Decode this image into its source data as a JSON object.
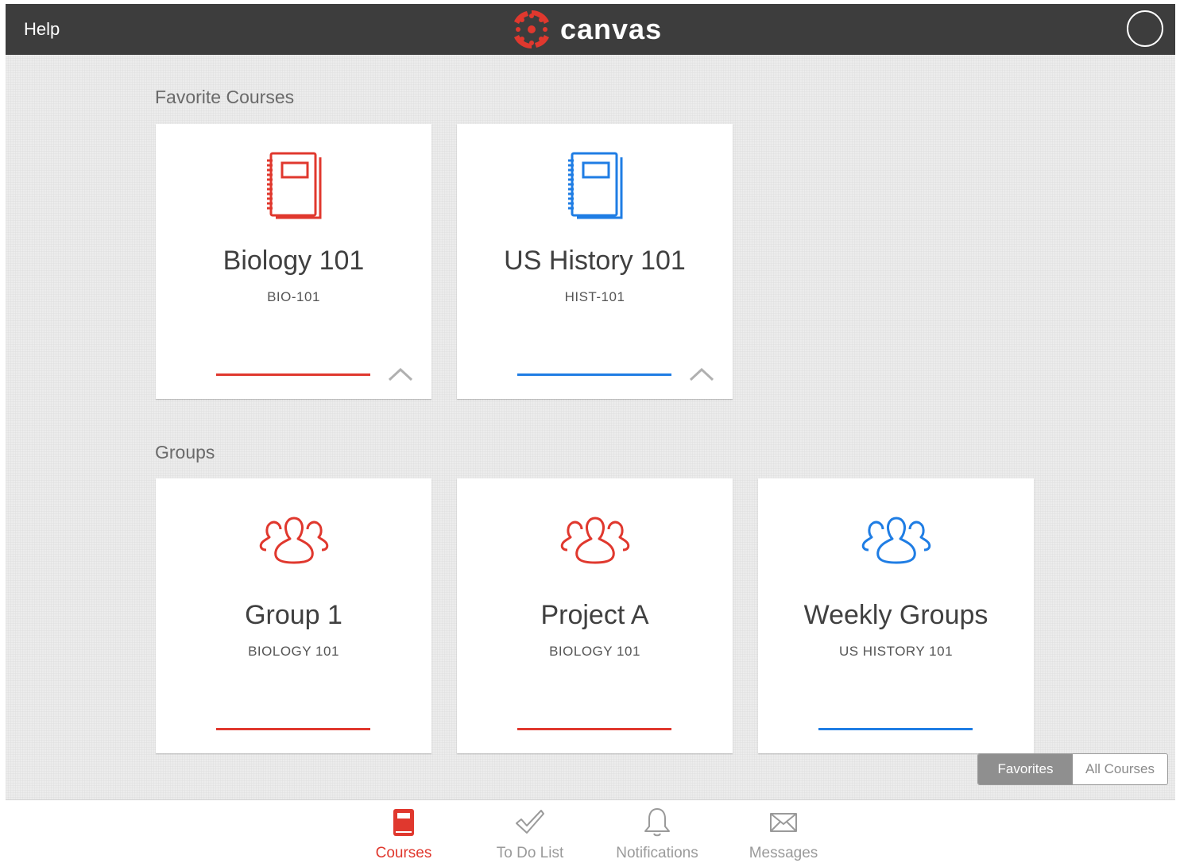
{
  "topbar": {
    "help_label": "Help",
    "logo_text": "canvas"
  },
  "colors": {
    "red": "#e0382e",
    "blue": "#1f7de4",
    "bar": "#3d3d3d"
  },
  "favorites": {
    "heading": "Favorite Courses",
    "cards": [
      {
        "title": "Biology 101",
        "subtitle": "BIO-101",
        "color": "#e0382e",
        "icon": "notebook-icon"
      },
      {
        "title": "US History 101",
        "subtitle": "HIST-101",
        "color": "#1f7de4",
        "icon": "notebook-icon"
      }
    ]
  },
  "groups": {
    "heading": "Groups",
    "cards": [
      {
        "title": "Group 1",
        "subtitle": "BIOLOGY 101",
        "color": "#e0382e",
        "icon": "people-icon"
      },
      {
        "title": "Project A",
        "subtitle": "BIOLOGY 101",
        "color": "#e0382e",
        "icon": "people-icon"
      },
      {
        "title": "Weekly Groups",
        "subtitle": "US HISTORY 101",
        "color": "#1f7de4",
        "icon": "people-icon"
      }
    ]
  },
  "toggle": {
    "favorites_label": "Favorites",
    "all_label": "All Courses",
    "selected": "Favorites"
  },
  "tabs": [
    {
      "label": "Courses",
      "icon": "book-icon",
      "active": true
    },
    {
      "label": "To Do List",
      "icon": "checkmark-icon",
      "active": false
    },
    {
      "label": "Notifications",
      "icon": "bell-icon",
      "active": false
    },
    {
      "label": "Messages",
      "icon": "envelope-icon",
      "active": false
    }
  ]
}
